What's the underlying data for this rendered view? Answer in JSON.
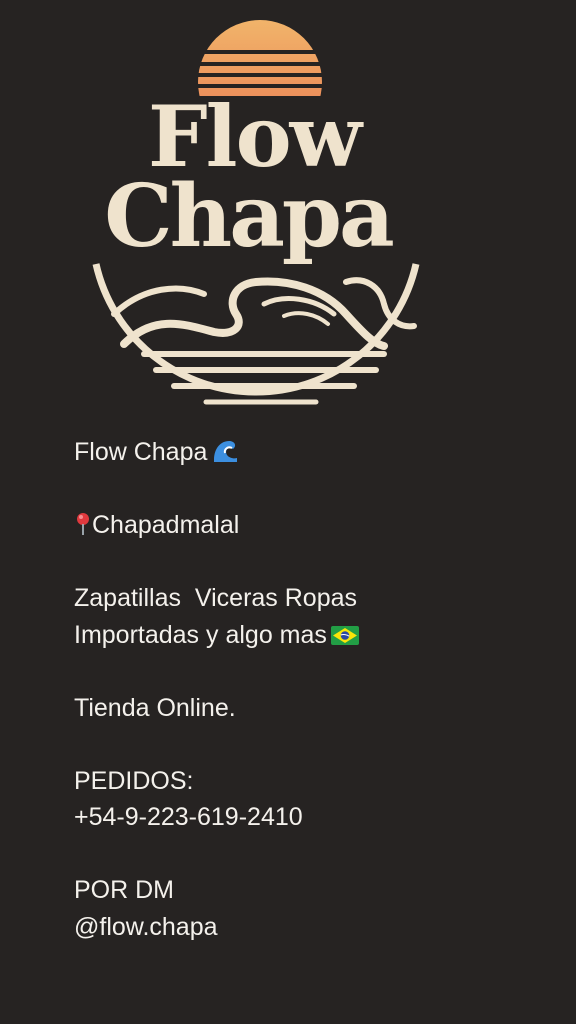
{
  "logo": {
    "line1": "Flow",
    "line2": "Chapa"
  },
  "bio": {
    "line1": "Flow Chapa",
    "line2": "Chapadmalal",
    "line3": "Zapatillas  Viceras Ropas",
    "line4": "Importadas y algo mas",
    "line5": "Tienda Online.",
    "line6": "PEDIDOS:",
    "line7": "+54-9-223-619-2410",
    "line8": "POR DM",
    "line9": "@flow.chapa"
  },
  "icons": {
    "wave": "water-wave-icon",
    "pin": "round-pushpin-icon",
    "flag": "brazil-flag-icon"
  },
  "colors": {
    "background": "#262322",
    "logo_cream": "#efe3cd",
    "sun_orange": "#e97a52",
    "sun_yellow": "#f1b46a",
    "text": "#f4f1ec"
  }
}
